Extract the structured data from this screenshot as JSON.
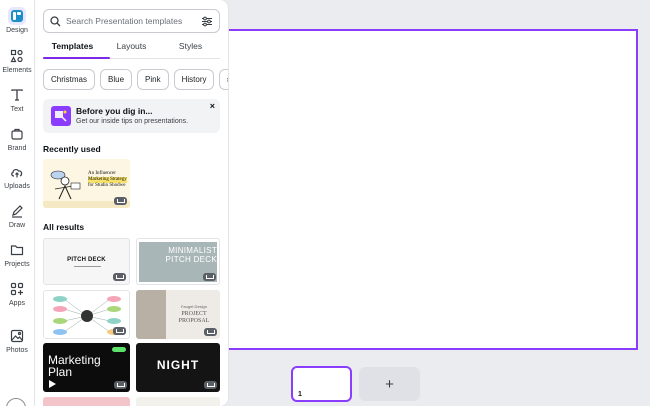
{
  "rail": {
    "items": [
      {
        "label": "Design",
        "icon": "design-icon"
      },
      {
        "label": "Elements",
        "icon": "elements-icon"
      },
      {
        "label": "Text",
        "icon": "text-icon"
      },
      {
        "label": "Brand",
        "icon": "brand-icon"
      },
      {
        "label": "Uploads",
        "icon": "uploads-icon"
      },
      {
        "label": "Draw",
        "icon": "draw-icon"
      },
      {
        "label": "Projects",
        "icon": "projects-icon"
      },
      {
        "label": "Apps",
        "icon": "apps-icon"
      },
      {
        "label": "Photos",
        "icon": "photos-icon"
      }
    ]
  },
  "panel": {
    "search_placeholder": "Search Presentation templates",
    "tabs": [
      {
        "label": "Templates"
      },
      {
        "label": "Layouts"
      },
      {
        "label": "Styles"
      }
    ],
    "chips": [
      {
        "label": "Christmas"
      },
      {
        "label": "Blue"
      },
      {
        "label": "Pink"
      },
      {
        "label": "History"
      }
    ],
    "chips_more": "›",
    "tip": {
      "title": "Before you dig in...",
      "subtitle": "Get our inside tips on presentations.",
      "close": "×"
    },
    "recently_used_title": "Recently used",
    "recent_template": {
      "line1": "An Influencer",
      "line2": "Marketing Strategy",
      "line3": "for Studio Shodwe"
    },
    "all_results_title": "All results",
    "results": [
      {
        "title": "PITCH DECK"
      },
      {
        "title": "MINIMALIST PITCH DECK"
      },
      {
        "title": "PROJECT PROPOSAL",
        "sub": "Fauget Design"
      },
      {
        "title": "Marketing Plan"
      },
      {
        "title": "NIGHT"
      }
    ]
  },
  "pages": {
    "current_page": "1",
    "add_label": "+"
  },
  "colors": {
    "accent": "#8b3dff",
    "panel_bg": "#ffffff",
    "workspace_bg": "#ebecf0"
  }
}
